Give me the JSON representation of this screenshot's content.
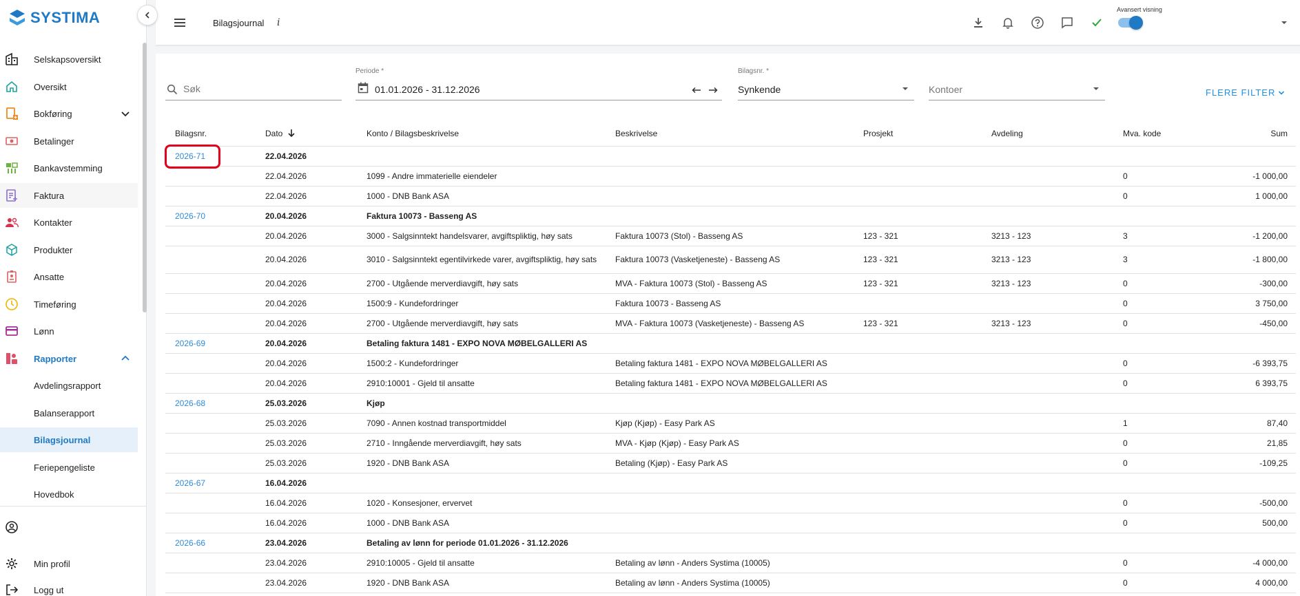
{
  "sidebar": {
    "brand": "SYSTIMA",
    "items": [
      {
        "label": "Selskapsoversikt",
        "icon": "building-icon",
        "color": "#222222"
      },
      {
        "label": "Oversikt",
        "icon": "home-icon",
        "color": "#1aa3a0"
      },
      {
        "label": "Bokføring",
        "icon": "book-add-icon",
        "color": "#f08a24"
      },
      {
        "label": "Betalinger",
        "icon": "payments-icon",
        "color": "#e06060"
      },
      {
        "label": "Bankavstemming",
        "icon": "bank-reconcile-icon",
        "color": "#6db33f"
      },
      {
        "label": "Faktura",
        "icon": "invoice-icon",
        "color": "#8a6ad8"
      },
      {
        "label": "Kontakter",
        "icon": "contacts-icon",
        "color": "#d8324f"
      },
      {
        "label": "Produkter",
        "icon": "box-icon",
        "color": "#1aa3a0"
      },
      {
        "label": "Ansatte",
        "icon": "badge-icon",
        "color": "#e06060"
      },
      {
        "label": "Timeføring",
        "icon": "clock-icon",
        "color": "#f0b400"
      },
      {
        "label": "Lønn",
        "icon": "card-icon",
        "color": "#a0309a"
      },
      {
        "label": "Rapporter",
        "icon": "report-icon",
        "color": "#e0506a"
      }
    ],
    "sub_items": [
      "Avdelingsrapport",
      "Balanserapport",
      "Bilagsjournal",
      "Feriepengeliste",
      "Hovedbok"
    ],
    "bottom": [
      {
        "label": "",
        "icon": "account-circle-icon"
      },
      {
        "label": "Min profil",
        "icon": "gear-icon"
      },
      {
        "label": "Logg ut",
        "icon": "logout-icon"
      }
    ]
  },
  "header": {
    "title": "Bilagsjournal",
    "info": "i",
    "advanced_label": "Avansert visning",
    "advanced_on": true
  },
  "filters": {
    "search_placeholder": "Søk",
    "periode_label": "Periode *",
    "periode_value": "01.01.2026 - 31.12.2026",
    "bilagsnr_label": "Bilagsnr. *",
    "bilagsnr_value": "Synkende",
    "kontoer_placeholder": "Kontoer",
    "more_filters": "FLERE FILTER"
  },
  "table": {
    "headers": [
      "Bilagsnr.",
      "Dato",
      "Konto / Bilagsbeskrivelse",
      "Beskrivelse",
      "Prosjekt",
      "Avdeling",
      "Mva. kode",
      "Sum"
    ],
    "rows": [
      {
        "type": "group",
        "bilag": "2026-71",
        "dato": "22.04.2026",
        "konto": "",
        "beskrivelse": "",
        "prosjekt": "",
        "avdeling": "",
        "mva": "",
        "sum": ""
      },
      {
        "type": "line",
        "bilag": "",
        "dato": "22.04.2026",
        "konto": "1099 - Andre immaterielle eiendeler",
        "beskrivelse": "",
        "prosjekt": "",
        "avdeling": "",
        "mva": "0",
        "sum": "-1 000,00"
      },
      {
        "type": "line",
        "bilag": "",
        "dato": "22.04.2026",
        "konto": "1000 - DNB Bank ASA",
        "beskrivelse": "",
        "prosjekt": "",
        "avdeling": "",
        "mva": "0",
        "sum": "1 000,00"
      },
      {
        "type": "group",
        "bilag": "2026-70",
        "dato": "20.04.2026",
        "konto": "Faktura 10073 - Basseng AS",
        "beskrivelse": "",
        "prosjekt": "",
        "avdeling": "",
        "mva": "",
        "sum": ""
      },
      {
        "type": "line",
        "bilag": "",
        "dato": "20.04.2026",
        "konto": "3000 - Salgsinntekt handelsvarer, avgiftspliktig, høy sats",
        "beskrivelse": "Faktura 10073 (Stol) - Basseng AS",
        "prosjekt": "123 - 321",
        "avdeling": "3213 - 123",
        "mva": "3",
        "sum": "-1 200,00"
      },
      {
        "type": "line",
        "tall": true,
        "bilag": "",
        "dato": "20.04.2026",
        "konto": "3010 - Salgsinntekt egentilvirkede varer, avgiftspliktig, høy sats",
        "beskrivelse": "Faktura 10073 (Vasketjeneste) - Basseng AS",
        "prosjekt": "123 - 321",
        "avdeling": "3213 - 123",
        "mva": "3",
        "sum": "-1 800,00"
      },
      {
        "type": "line",
        "bilag": "",
        "dato": "20.04.2026",
        "konto": "2700 - Utgående merverdiavgift, høy sats",
        "beskrivelse": "MVA - Faktura 10073 (Stol) - Basseng AS",
        "prosjekt": "123 - 321",
        "avdeling": "3213 - 123",
        "mva": "0",
        "sum": "-300,00"
      },
      {
        "type": "line",
        "bilag": "",
        "dato": "20.04.2026",
        "konto": "1500:9 - Kundefordringer",
        "beskrivelse": "Faktura 10073 - Basseng AS",
        "prosjekt": "",
        "avdeling": "",
        "mva": "0",
        "sum": "3 750,00"
      },
      {
        "type": "line",
        "bilag": "",
        "dato": "20.04.2026",
        "konto": "2700 - Utgående merverdiavgift, høy sats",
        "beskrivelse": "MVA - Faktura 10073 (Vasketjeneste) - Basseng AS",
        "prosjekt": "123 - 321",
        "avdeling": "3213 - 123",
        "mva": "0",
        "sum": "-450,00"
      },
      {
        "type": "group",
        "bilag": "2026-69",
        "dato": "20.04.2026",
        "konto": "Betaling faktura 1481 - EXPO NOVA MØBELGALLERI AS",
        "beskrivelse": "",
        "prosjekt": "",
        "avdeling": "",
        "mva": "",
        "sum": ""
      },
      {
        "type": "line",
        "bilag": "",
        "dato": "20.04.2026",
        "konto": "1500:2 - Kundefordringer",
        "beskrivelse": "Betaling faktura 1481 - EXPO NOVA MØBELGALLERI AS",
        "prosjekt": "",
        "avdeling": "",
        "mva": "0",
        "sum": "-6 393,75"
      },
      {
        "type": "line",
        "bilag": "",
        "dato": "20.04.2026",
        "konto": "2910:10001 - Gjeld til ansatte",
        "beskrivelse": "Betaling faktura 1481 - EXPO NOVA MØBELGALLERI AS",
        "prosjekt": "",
        "avdeling": "",
        "mva": "0",
        "sum": "6 393,75"
      },
      {
        "type": "group",
        "bilag": "2026-68",
        "dato": "25.03.2026",
        "konto": "Kjøp",
        "beskrivelse": "",
        "prosjekt": "",
        "avdeling": "",
        "mva": "",
        "sum": ""
      },
      {
        "type": "line",
        "bilag": "",
        "dato": "25.03.2026",
        "konto": "7090 - Annen kostnad transportmiddel",
        "beskrivelse": "Kjøp (Kjøp) - Easy Park AS",
        "prosjekt": "",
        "avdeling": "",
        "mva": "1",
        "sum": "87,40"
      },
      {
        "type": "line",
        "bilag": "",
        "dato": "25.03.2026",
        "konto": "2710 - Inngående merverdiavgift, høy sats",
        "beskrivelse": "MVA - Kjøp (Kjøp) - Easy Park AS",
        "prosjekt": "",
        "avdeling": "",
        "mva": "0",
        "sum": "21,85"
      },
      {
        "type": "line",
        "bilag": "",
        "dato": "25.03.2026",
        "konto": "1920 - DNB Bank ASA",
        "beskrivelse": "Betaling (Kjøp) - Easy Park AS",
        "prosjekt": "",
        "avdeling": "",
        "mva": "0",
        "sum": "-109,25"
      },
      {
        "type": "group",
        "bilag": "2026-67",
        "dato": "16.04.2026",
        "konto": "",
        "beskrivelse": "",
        "prosjekt": "",
        "avdeling": "",
        "mva": "",
        "sum": ""
      },
      {
        "type": "line",
        "bilag": "",
        "dato": "16.04.2026",
        "konto": "1020 - Konsesjoner, ervervet",
        "beskrivelse": "",
        "prosjekt": "",
        "avdeling": "",
        "mva": "0",
        "sum": "-500,00"
      },
      {
        "type": "line",
        "bilag": "",
        "dato": "16.04.2026",
        "konto": "1000 - DNB Bank ASA",
        "beskrivelse": "",
        "prosjekt": "",
        "avdeling": "",
        "mva": "0",
        "sum": "500,00"
      },
      {
        "type": "group",
        "bilag": "2026-66",
        "dato": "23.04.2026",
        "konto": "Betaling av lønn for periode 01.01.2026 - 31.12.2026",
        "beskrivelse": "",
        "prosjekt": "",
        "avdeling": "",
        "mva": "",
        "sum": ""
      },
      {
        "type": "line",
        "bilag": "",
        "dato": "23.04.2026",
        "konto": "2910:10005 - Gjeld til ansatte",
        "beskrivelse": "Betaling av lønn - Anders Systima (10005)",
        "prosjekt": "",
        "avdeling": "",
        "mva": "0",
        "sum": "-4 000,00"
      },
      {
        "type": "line",
        "bilag": "",
        "dato": "23.04.2026",
        "konto": "1920 - DNB Bank ASA",
        "beskrivelse": "Betaling av lønn - Anders Systima (10005)",
        "prosjekt": "",
        "avdeling": "",
        "mva": "0",
        "sum": "4 000,00"
      }
    ]
  },
  "colors": {
    "accent": "#1f79c4",
    "link": "#2f8bd8",
    "highlight": "#e2001a"
  }
}
